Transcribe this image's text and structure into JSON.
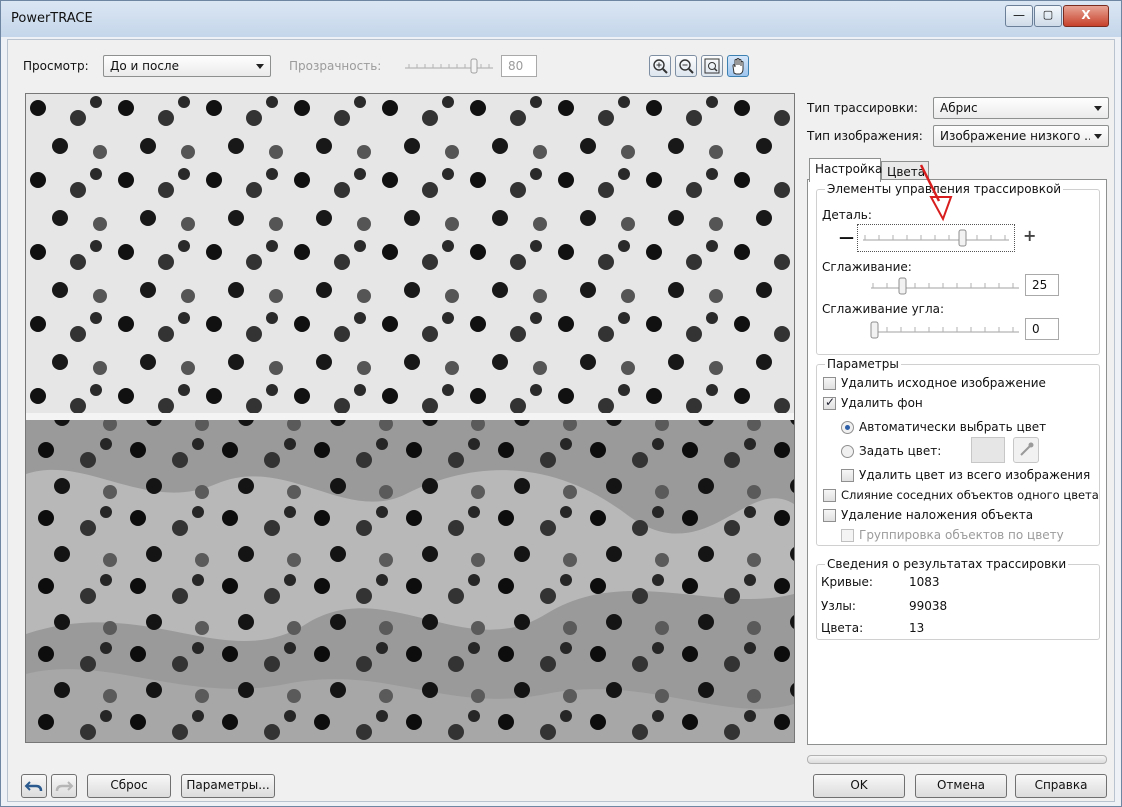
{
  "window": {
    "title": "PowerTRACE",
    "minimize_label": "—",
    "maximize_label": "▢",
    "close_label": "X"
  },
  "toolbar": {
    "view_label": "Просмотр:",
    "view_value": "До и после",
    "transparency_label": "Прозрачность:",
    "transparency_value": "80",
    "tools": [
      "zoom-in-icon",
      "zoom-out-icon",
      "fit-icon",
      "hand-pan-icon"
    ]
  },
  "settings": {
    "trace_type_label": "Тип трассировки:",
    "trace_type_value": "Абрис",
    "image_type_label": "Тип изображения:",
    "image_type_value": "Изображение низкого ..."
  },
  "tabs": [
    "Настройка",
    "Цвета"
  ],
  "trace_controls": {
    "group_title": "Элементы управления трассировкой",
    "detail_label": "Деталь:",
    "minus_label": "—",
    "plus_label": "+",
    "detail_level": 0.68,
    "smoothing_label": "Сглаживание:",
    "smoothing_value": "25",
    "corner_label": "Сглаживание угла:",
    "corner_value": "0"
  },
  "parameters": {
    "group_title": "Параметры",
    "remove_original": "Удалить исходное изображение",
    "remove_background": "Удалить фон",
    "auto_color": "Автоматически выбрать цвет",
    "set_color": "Задать цвет:",
    "remove_color_all": "Удалить цвет из всего изображения",
    "merge_adjacent": "Слияние соседних объектов одного цвета",
    "remove_overlap": "Удаление наложения объекта",
    "group_by_color": "Группировка объектов по цвету"
  },
  "results": {
    "group_title": "Сведения о результатах трассировки",
    "rows": [
      {
        "label": "Кривые:",
        "value": "1083"
      },
      {
        "label": "Узлы:",
        "value": "99038"
      },
      {
        "label": "Цвета:",
        "value": "13"
      }
    ]
  },
  "bottom": {
    "reset": "Сброс",
    "options": "Параметры...",
    "ok": "OK",
    "cancel": "Отмена",
    "help": "Справка"
  },
  "colors": {
    "accent_arrow": "#d81e1e",
    "title_bg": "#c9d9ea"
  }
}
